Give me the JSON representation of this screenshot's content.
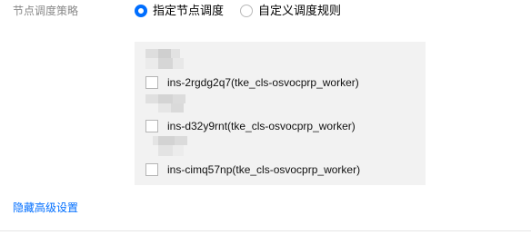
{
  "scheduling": {
    "label": "节点调度策略",
    "options": [
      {
        "label": "指定节点调度",
        "checked": true
      },
      {
        "label": "自定义调度规则",
        "checked": false
      }
    ]
  },
  "nodes": [
    {
      "name": "ins-2rgdg2q7(tke_cls-osvocprp_worker)",
      "checked": false
    },
    {
      "name": "ins-d32y9rnt(tke_cls-osvocprp_worker)",
      "checked": false
    },
    {
      "name": "ins-cimq57np(tke_cls-osvocprp_worker)",
      "checked": false
    }
  ],
  "advanced_link": "隐藏高级设置",
  "colors": {
    "accent": "#006eff",
    "label_gray": "#888888",
    "panel_bg": "#f2f2f2"
  }
}
